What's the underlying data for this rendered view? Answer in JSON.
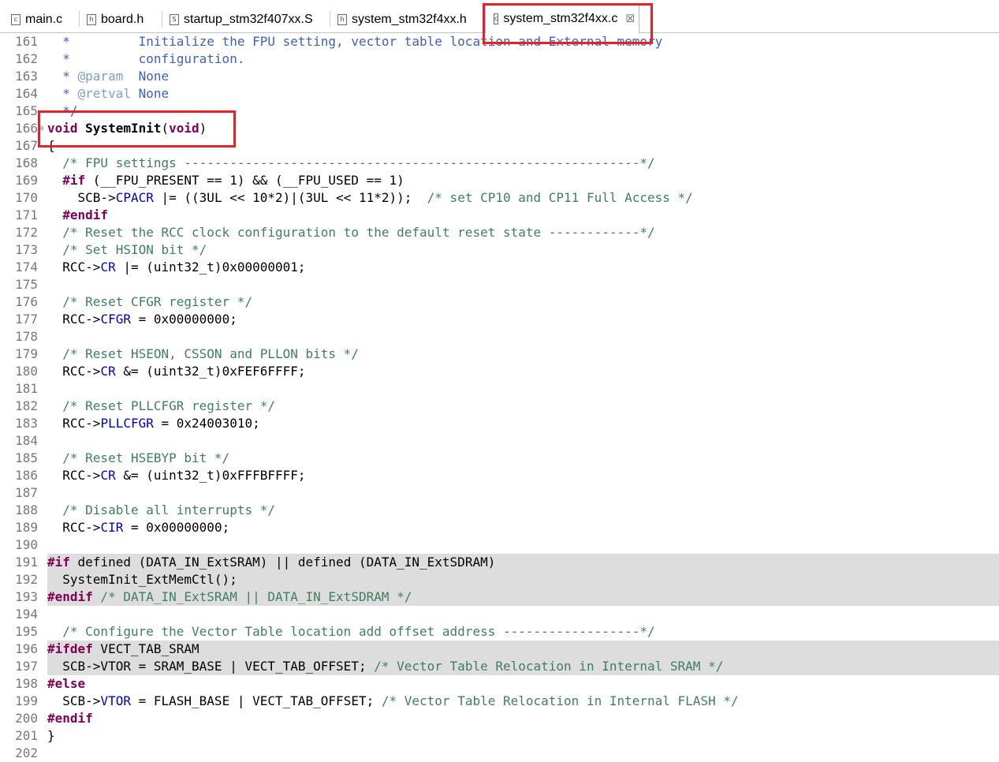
{
  "tabs": [
    {
      "label": "main.c",
      "icon": "c-file-icon"
    },
    {
      "label": "board.h",
      "icon": "h-file-icon"
    },
    {
      "label": "startup_stm32f407xx.S",
      "icon": "s-file-icon"
    },
    {
      "label": "system_stm32f4xx.h",
      "icon": "h-file-icon"
    },
    {
      "label": "system_stm32f4xx.c",
      "icon": "c-file-icon",
      "active": true
    }
  ],
  "close_glyph": "☒",
  "lines": [
    {
      "n": "161",
      "parts": [
        [
          "doc",
          "  *         Initialize the FPU setting, vector table location and External memory"
        ]
      ]
    },
    {
      "n": "162",
      "parts": [
        [
          "doc",
          "  *         configuration."
        ]
      ]
    },
    {
      "n": "163",
      "parts": [
        [
          "doc",
          "  * "
        ],
        [
          "tag",
          "@param"
        ],
        [
          "doc",
          "  None"
        ]
      ]
    },
    {
      "n": "164",
      "parts": [
        [
          "doc",
          "  * "
        ],
        [
          "tag",
          "@retval"
        ],
        [
          "doc",
          " None"
        ]
      ]
    },
    {
      "n": "165",
      "parts": [
        [
          "doc",
          "  */"
        ]
      ]
    },
    {
      "n": "166",
      "parts": [
        [
          "kw",
          "void"
        ],
        [
          "b",
          " SystemInit"
        ],
        [
          "",
          "("
        ],
        [
          "kw",
          "void"
        ],
        [
          "",
          ")"
        ]
      ],
      "fold": "⊖"
    },
    {
      "n": "167",
      "parts": [
        [
          "",
          "{"
        ]
      ]
    },
    {
      "n": "168",
      "parts": [
        [
          "com",
          "  /* FPU settings ------------------------------------------------------------*/"
        ]
      ]
    },
    {
      "n": "169",
      "parts": [
        [
          "kw",
          "  #if"
        ],
        [
          "",
          " (__FPU_PRESENT == 1) && (__FPU_USED == 1)"
        ]
      ]
    },
    {
      "n": "170",
      "parts": [
        [
          "",
          "    SCB->"
        ],
        [
          "fld",
          "CPACR"
        ],
        [
          "",
          " |= ((3UL << 10*2)|(3UL << 11*2));  "
        ],
        [
          "com",
          "/* set CP10 and CP11 Full Access */"
        ]
      ]
    },
    {
      "n": "171",
      "parts": [
        [
          "kw",
          "  #endif"
        ]
      ]
    },
    {
      "n": "172",
      "parts": [
        [
          "com",
          "  /* Reset the RCC clock configuration to the default reset state ------------*/"
        ]
      ]
    },
    {
      "n": "173",
      "parts": [
        [
          "com",
          "  /* Set HSION bit */"
        ]
      ]
    },
    {
      "n": "174",
      "parts": [
        [
          "",
          "  RCC->"
        ],
        [
          "fld",
          "CR"
        ],
        [
          "",
          " |= (uint32_t)0x00000001;"
        ]
      ]
    },
    {
      "n": "175",
      "parts": []
    },
    {
      "n": "176",
      "parts": [
        [
          "com",
          "  /* Reset CFGR register */"
        ]
      ]
    },
    {
      "n": "177",
      "parts": [
        [
          "",
          "  RCC->"
        ],
        [
          "fld",
          "CFGR"
        ],
        [
          "",
          " = 0x00000000;"
        ]
      ]
    },
    {
      "n": "178",
      "parts": []
    },
    {
      "n": "179",
      "parts": [
        [
          "com",
          "  /* Reset HSEON, CSSON and PLLON bits */"
        ]
      ]
    },
    {
      "n": "180",
      "parts": [
        [
          "",
          "  RCC->"
        ],
        [
          "fld",
          "CR"
        ],
        [
          "",
          " &= (uint32_t)0xFEF6FFFF;"
        ]
      ]
    },
    {
      "n": "181",
      "parts": []
    },
    {
      "n": "182",
      "parts": [
        [
          "com",
          "  /* Reset PLLCFGR register */"
        ]
      ]
    },
    {
      "n": "183",
      "parts": [
        [
          "",
          "  RCC->"
        ],
        [
          "fld",
          "PLLCFGR"
        ],
        [
          "",
          " = 0x24003010;"
        ]
      ]
    },
    {
      "n": "184",
      "parts": []
    },
    {
      "n": "185",
      "parts": [
        [
          "com",
          "  /* Reset HSEBYP bit */"
        ]
      ]
    },
    {
      "n": "186",
      "parts": [
        [
          "",
          "  RCC->"
        ],
        [
          "fld",
          "CR"
        ],
        [
          "",
          " &= (uint32_t)0xFFFBFFFF;"
        ]
      ]
    },
    {
      "n": "187",
      "parts": []
    },
    {
      "n": "188",
      "parts": [
        [
          "com",
          "  /* Disable all interrupts */"
        ]
      ]
    },
    {
      "n": "189",
      "parts": [
        [
          "",
          "  RCC->"
        ],
        [
          "fld",
          "CIR"
        ],
        [
          "",
          " = 0x00000000;"
        ]
      ]
    },
    {
      "n": "190",
      "parts": []
    },
    {
      "n": "191",
      "parts": [
        [
          "kw",
          "#if"
        ],
        [
          "",
          " defined (DATA_IN_ExtSRAM) || defined (DATA_IN_ExtSDRAM)"
        ]
      ],
      "hl": true
    },
    {
      "n": "192",
      "parts": [
        [
          "",
          "  SystemInit_ExtMemCtl();"
        ]
      ],
      "hl": true
    },
    {
      "n": "193",
      "parts": [
        [
          "kw",
          "#endif"
        ],
        [
          "com",
          " /* DATA_IN_ExtSRAM || DATA_IN_ExtSDRAM */"
        ]
      ],
      "hl": true
    },
    {
      "n": "194",
      "parts": []
    },
    {
      "n": "195",
      "parts": [
        [
          "com",
          "  /* Configure the Vector Table location add offset address ------------------*/"
        ]
      ]
    },
    {
      "n": "196",
      "parts": [
        [
          "kw",
          "#ifdef"
        ],
        [
          "",
          " VECT_TAB_SRAM"
        ]
      ],
      "hl": true
    },
    {
      "n": "197",
      "parts": [
        [
          "",
          "  SCB->VTOR = SRAM_BASE | VECT_TAB_OFFSET; "
        ],
        [
          "com",
          "/* Vector Table Relocation in Internal SRAM */"
        ]
      ],
      "hl": true
    },
    {
      "n": "198",
      "parts": [
        [
          "kw",
          "#else"
        ]
      ]
    },
    {
      "n": "199",
      "parts": [
        [
          "",
          "  SCB->"
        ],
        [
          "fld",
          "VTOR"
        ],
        [
          "",
          " = FLASH_BASE | VECT_TAB_OFFSET; "
        ],
        [
          "com",
          "/* Vector Table Relocation in Internal FLASH */"
        ]
      ]
    },
    {
      "n": "200",
      "parts": [
        [
          "kw",
          "#endif"
        ]
      ]
    },
    {
      "n": "201",
      "parts": [
        [
          "",
          "}"
        ]
      ]
    },
    {
      "n": "202",
      "parts": []
    }
  ],
  "colors": {
    "annotation_box": "#e8202a",
    "comment": "#3f7f5f",
    "doc_comment": "#3f5fbf",
    "keyword": "#7f0055",
    "field": "#0000c0",
    "inactive_highlight": "#dddddd"
  }
}
